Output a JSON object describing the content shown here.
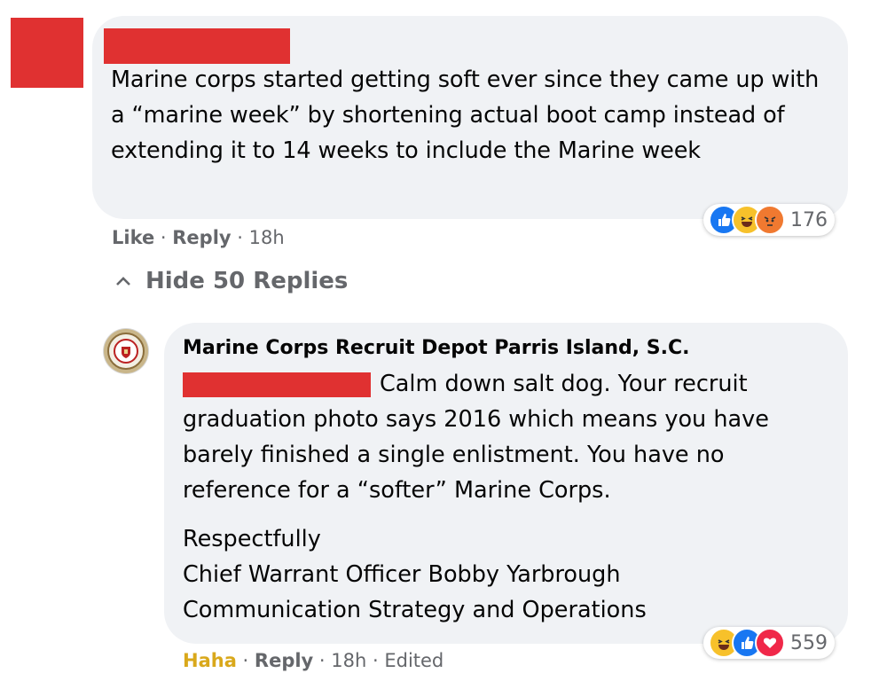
{
  "top_comment": {
    "text": "Marine corps started getting soft ever since they came up with a “marine week” by shortening actual boot camp instead of extending it to 14 weeks to include the Marine week",
    "reaction_count": "176",
    "actions": {
      "like": "Like",
      "reply": "Reply",
      "time": "18h"
    },
    "reactions": [
      "like-icon",
      "haha-icon",
      "angry-icon"
    ]
  },
  "thread": {
    "hide_replies_label": "Hide 50 Replies"
  },
  "reply": {
    "author": "Marine Corps Recruit Depot Parris Island, S.C.",
    "text": "Calm down salt dog. Your recruit graduation photo says 2016 which means you have barely finished a single enlistment. You have no reference for a “softer” Marine Corps.",
    "signature": [
      "Respectfully",
      "Chief Warrant Officer Bobby Yarbrough",
      "Communication Strategy and Operations"
    ],
    "reaction_count": "559",
    "actions": {
      "reaction_label": "Haha",
      "reply": "Reply",
      "time": "18h",
      "edited": "Edited"
    },
    "reactions": [
      "haha-icon",
      "like-icon",
      "love-icon"
    ]
  },
  "colors": {
    "redaction": "#e03131",
    "bubble": "#f0f2f5",
    "meta": "#65676b",
    "haha": "#d9a81b"
  }
}
